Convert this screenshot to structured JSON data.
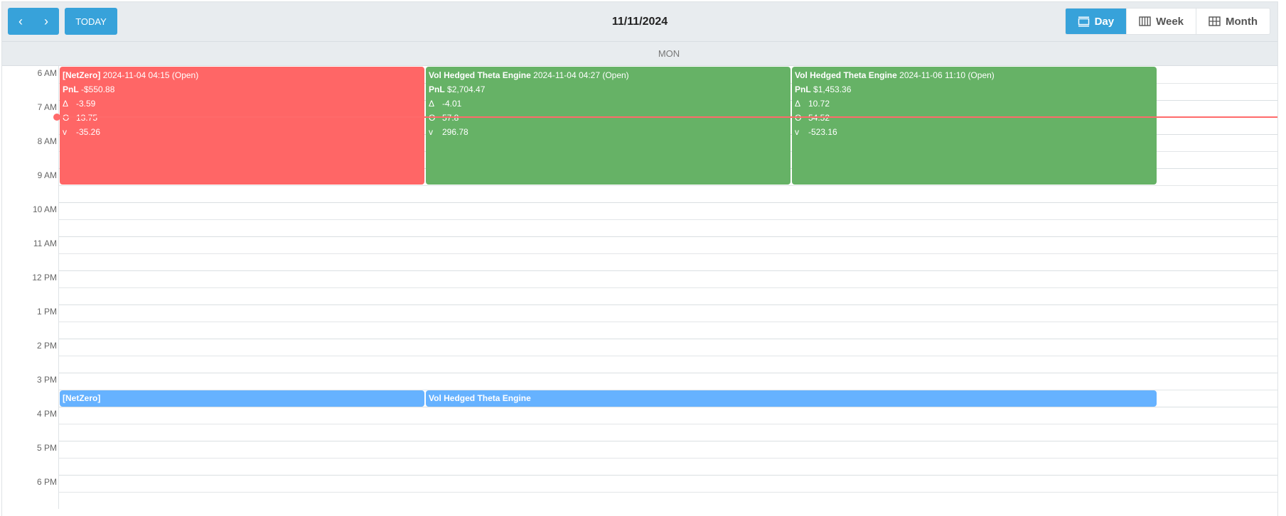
{
  "toolbar": {
    "prev_icon": "chevron-left-icon",
    "next_icon": "chevron-right-icon",
    "prev_glyph": "‹",
    "next_glyph": "›",
    "today_label": "TODAY",
    "title": "11/11/2024",
    "views": [
      {
        "label": "Day",
        "icon": "day-view-icon",
        "active": true
      },
      {
        "label": "Week",
        "icon": "week-view-icon",
        "active": false
      },
      {
        "label": "Month",
        "icon": "month-view-icon",
        "active": false
      }
    ]
  },
  "day_header": "MON",
  "hours": [
    "6 AM",
    "7 AM",
    "8 AM",
    "9 AM",
    "10 AM",
    "11 AM",
    "12 PM",
    "1 PM",
    "2 PM",
    "3 PM",
    "4 PM",
    "5 PM",
    "6 PM"
  ],
  "grid_start_hour": 6,
  "grid_end_hour": 19,
  "current_time_hour": 7.5,
  "colors": {
    "primary": "#37a2da",
    "loss": "#ff6666",
    "profit": "#66b266",
    "pending": "#66b2ff",
    "now_line": "#ff6a6a"
  },
  "events": [
    {
      "name": "[NetZero]",
      "detail": "2024-11-04 04:15 (Open)",
      "pnl_label": "PnL",
      "pnl": "-$550.88",
      "greeks": [
        {
          "symbol": "Δ",
          "value": "-3.59"
        },
        {
          "symbol": "Θ",
          "value": "13.75"
        },
        {
          "symbol": "v",
          "value": "-35.26"
        }
      ],
      "status": "loss",
      "start_hour": 6.0,
      "end_hour": 9.45,
      "column": 0
    },
    {
      "name": "Vol Hedged Theta Engine",
      "detail": "2024-11-04 04:27 (Open)",
      "pnl_label": "PnL",
      "pnl": "$2,704.47",
      "greeks": [
        {
          "symbol": "Δ",
          "value": "-4.01"
        },
        {
          "symbol": "Θ",
          "value": "57.8"
        },
        {
          "symbol": "v",
          "value": "296.78"
        }
      ],
      "status": "profit",
      "start_hour": 6.0,
      "end_hour": 9.45,
      "column": 1
    },
    {
      "name": "Vol Hedged Theta Engine",
      "detail": "2024-11-06 11:10 (Open)",
      "pnl_label": "PnL",
      "pnl": "$1,453.36",
      "greeks": [
        {
          "symbol": "Δ",
          "value": "10.72"
        },
        {
          "symbol": "Θ",
          "value": "54.52"
        },
        {
          "symbol": "v",
          "value": "-523.16"
        }
      ],
      "status": "profit",
      "start_hour": 6.0,
      "end_hour": 9.45,
      "column": 2
    },
    {
      "name": "[NetZero]",
      "status": "pending",
      "start_hour": 15.5,
      "end_hour": 15.98,
      "column": 0,
      "span": 1
    },
    {
      "name": "Vol Hedged Theta Engine",
      "status": "pending",
      "start_hour": 15.5,
      "end_hour": 15.98,
      "column": 1,
      "span": 2
    }
  ]
}
